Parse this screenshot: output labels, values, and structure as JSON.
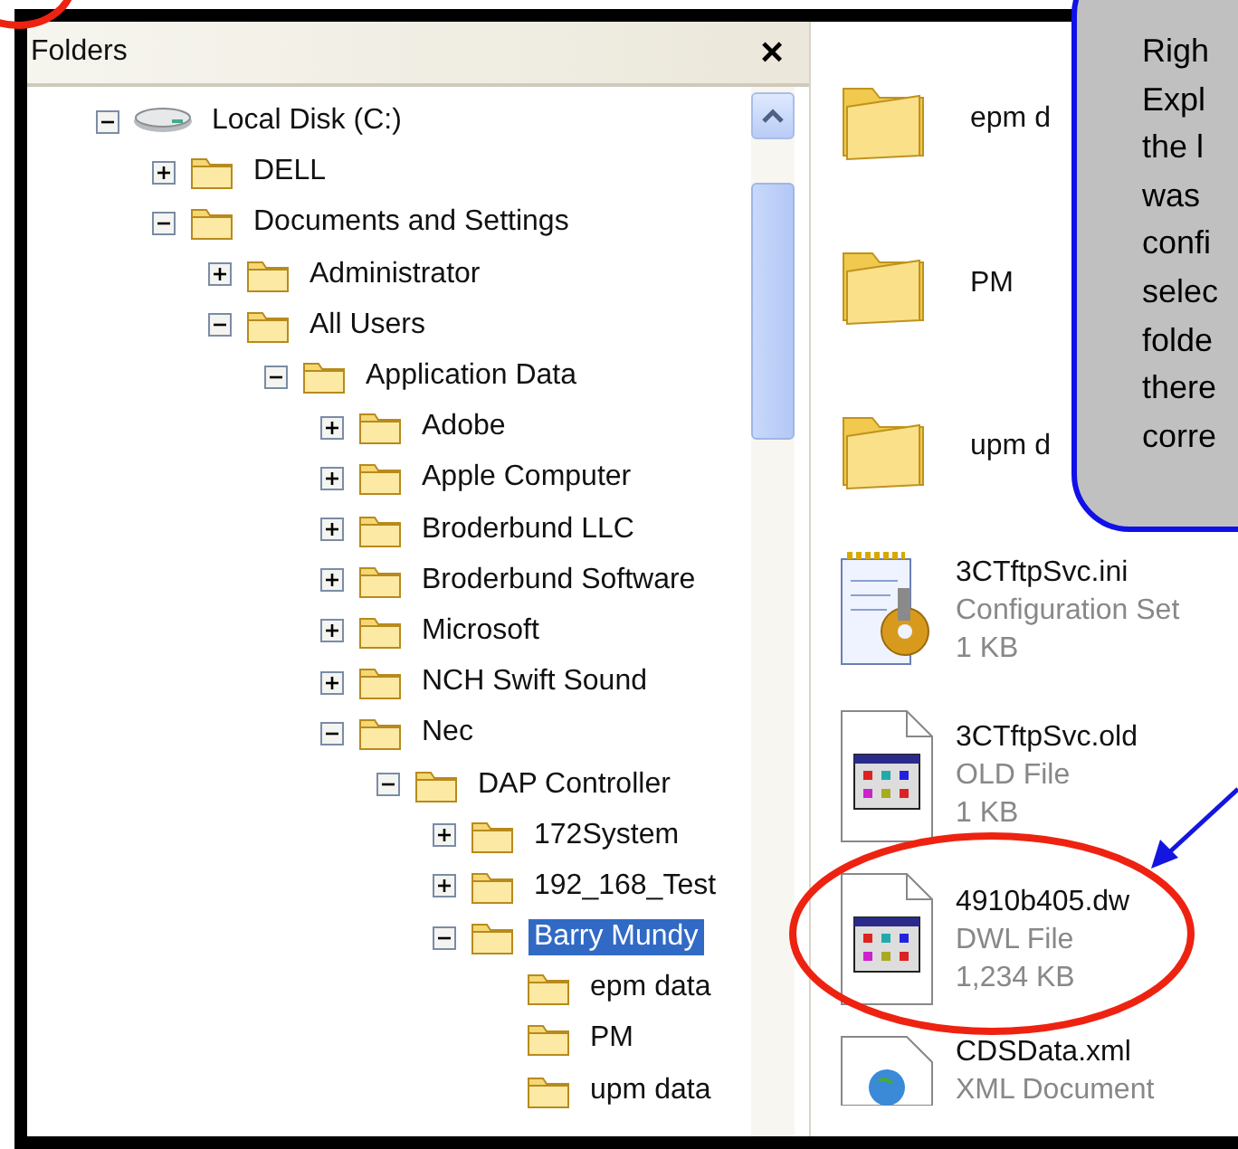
{
  "folders_pane": {
    "title": "Folders",
    "close": "×",
    "tree": [
      {
        "label": "Local Disk (C:)",
        "kind": "drive",
        "expanded": true,
        "selected": false,
        "children": [
          {
            "label": "DELL",
            "kind": "folder",
            "expanded": false,
            "selected": false
          },
          {
            "label": "Documents and Settings",
            "kind": "folder",
            "expanded": true,
            "selected": false,
            "children": [
              {
                "label": "Administrator",
                "kind": "folder",
                "expanded": false,
                "selected": false
              },
              {
                "label": "All Users",
                "kind": "folder",
                "expanded": true,
                "selected": false,
                "children": [
                  {
                    "label": "Application Data",
                    "kind": "folder",
                    "expanded": true,
                    "selected": false,
                    "children": [
                      {
                        "label": "Adobe",
                        "kind": "folder",
                        "expanded": false,
                        "selected": false
                      },
                      {
                        "label": "Apple Computer",
                        "kind": "folder",
                        "expanded": false,
                        "selected": false
                      },
                      {
                        "label": "Broderbund LLC",
                        "kind": "folder",
                        "expanded": false,
                        "selected": false
                      },
                      {
                        "label": "Broderbund Software",
                        "kind": "folder",
                        "expanded": false,
                        "selected": false
                      },
                      {
                        "label": "Microsoft",
                        "kind": "folder",
                        "expanded": false,
                        "selected": false
                      },
                      {
                        "label": "NCH Swift Sound",
                        "kind": "folder",
                        "expanded": false,
                        "selected": false
                      },
                      {
                        "label": "Nec",
                        "kind": "folder",
                        "expanded": true,
                        "selected": false,
                        "children": [
                          {
                            "label": "DAP Controller",
                            "kind": "folder",
                            "expanded": true,
                            "selected": false,
                            "children": [
                              {
                                "label": "172System",
                                "kind": "folder",
                                "expanded": false,
                                "selected": false
                              },
                              {
                                "label": "192_168_Test",
                                "kind": "folder",
                                "expanded": false,
                                "selected": false
                              },
                              {
                                "label": "Barry Mundy",
                                "kind": "folder",
                                "expanded": true,
                                "selected": true,
                                "children": [
                                  {
                                    "label": "epm data",
                                    "kind": "folder",
                                    "selected": false
                                  },
                                  {
                                    "label": "PM",
                                    "kind": "folder",
                                    "selected": false
                                  },
                                  {
                                    "label": "upm data",
                                    "kind": "folder",
                                    "selected": false
                                  }
                                ]
                              }
                            ]
                          }
                        ]
                      }
                    ]
                  }
                ]
              }
            ]
          }
        ]
      }
    ]
  },
  "files_pane": {
    "items": [
      {
        "kind": "folder",
        "name": "epm d"
      },
      {
        "kind": "folder",
        "name": "PM"
      },
      {
        "kind": "folder",
        "name": "upm d"
      },
      {
        "kind": "settings",
        "name": "3CTftpSvc.ini",
        "type": "Configuration Set",
        "size": "1 KB"
      },
      {
        "kind": "window",
        "name": "3CTftpSvc.old",
        "type": "OLD File",
        "size": "1 KB"
      },
      {
        "kind": "window",
        "name": "4910b405.dw",
        "type": "DWL File",
        "size": "1,234 KB"
      },
      {
        "kind": "web",
        "name": "CDSData.xml",
        "type": "XML Document"
      }
    ]
  },
  "callout": {
    "lines": [
      "Righ",
      "Expl",
      "the l",
      "was",
      "confi",
      "selec",
      "folde",
      "there",
      "corre"
    ]
  }
}
